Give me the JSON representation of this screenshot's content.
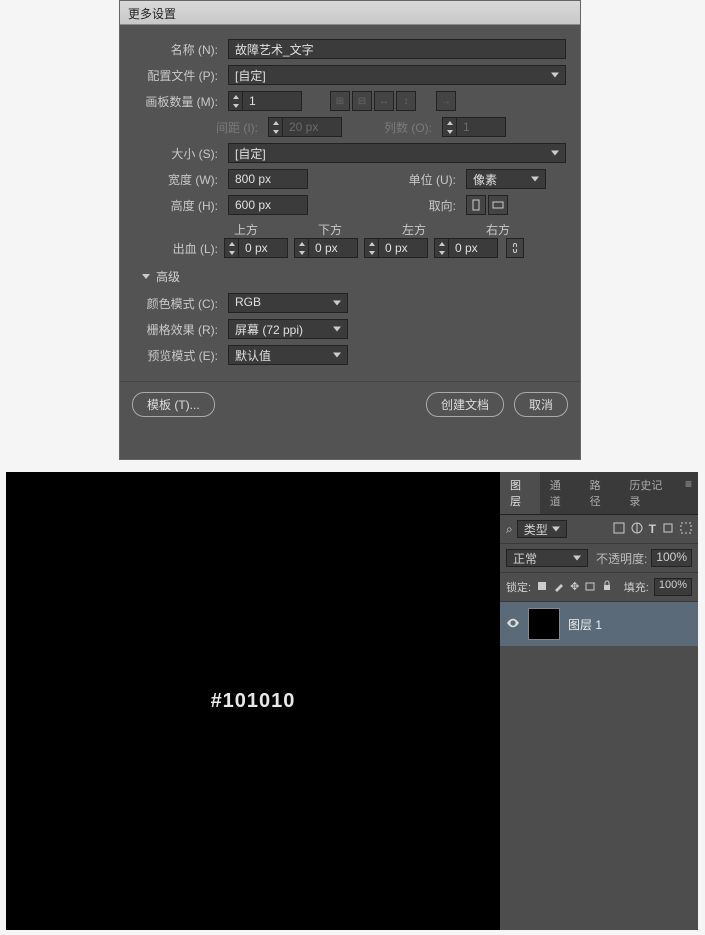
{
  "dialog": {
    "title": "更多设置",
    "name_label": "名称 (N):",
    "name_value": "故障艺术_文字",
    "profile_label": "配置文件 (P):",
    "profile_value": "[自定]",
    "artboards_label": "画板数量 (M):",
    "artboards_value": "1",
    "spacing_label": "间距 (I):",
    "spacing_value": "20 px",
    "cols_label": "列数 (O):",
    "cols_value": "1",
    "size_label": "大小 (S):",
    "size_value": "[自定]",
    "width_label": "宽度 (W):",
    "width_value": "800 px",
    "units_label": "单位 (U):",
    "units_value": "像素",
    "height_label": "高度 (H):",
    "height_value": "600 px",
    "orient_label": "取向:",
    "bleed_label": "出血 (L):",
    "bleed_top": "上方",
    "bleed_bottom": "下方",
    "bleed_left": "左方",
    "bleed_right": "右方",
    "bleed_val": "0 px",
    "advanced_label": "高级",
    "colormode_label": "颜色模式 (C):",
    "colormode_value": "RGB",
    "raster_label": "栅格效果 (R):",
    "raster_value": "屏幕 (72 ppi)",
    "preview_label": "预览模式 (E):",
    "preview_value": "默认值",
    "templates_btn": "模板 (T)...",
    "create_btn": "创建文档",
    "cancel_btn": "取消"
  },
  "bottom": {
    "canvas_text": "#101010",
    "tab_layers": "图层",
    "tab_channels": "通道",
    "tab_paths": "路径",
    "tab_history": "历史记录",
    "filter_kind": "类型",
    "blend_mode": "正常",
    "opacity_label": "不透明度:",
    "opacity_value": "100%",
    "lock_label": "锁定:",
    "fill_label": "填充:",
    "fill_value": "100%",
    "layer1": "图层 1",
    "search_glyph": "⌕"
  }
}
